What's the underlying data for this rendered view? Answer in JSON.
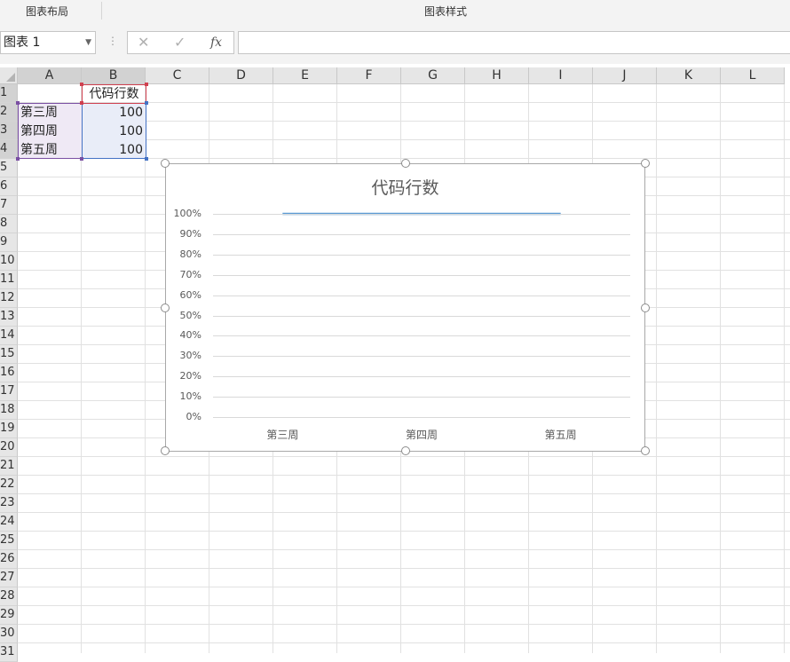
{
  "ribbon": {
    "chart_layout_group": "图表布局",
    "chart_style_group": "图表样式"
  },
  "formula_bar": {
    "name_box": "图表 1",
    "cancel_icon": "close-icon",
    "enter_icon": "check-icon",
    "function_label": "fx",
    "formula": ""
  },
  "columns": [
    "A",
    "B",
    "C",
    "D",
    "E",
    "F",
    "G",
    "H",
    "I",
    "J",
    "K",
    "L"
  ],
  "rows": [
    "1",
    "2",
    "3",
    "4",
    "5",
    "6",
    "7",
    "8",
    "9",
    "10",
    "11",
    "12",
    "13",
    "14",
    "15",
    "16",
    "17",
    "18",
    "19",
    "20",
    "21",
    "22",
    "23",
    "24",
    "25",
    "26",
    "27",
    "28",
    "29",
    "30",
    "31"
  ],
  "cells": {
    "B1": "代码行数",
    "A2": "第三周",
    "B2": "100",
    "A3": "第四周",
    "B3": "100",
    "A4": "第五周",
    "B4": "100"
  },
  "colors": {
    "series_line": "#5b9bd5",
    "range_blue": "#4472c4",
    "range_purple": "#7a4fa3",
    "range_red": "#d0404f"
  },
  "chart_data": {
    "type": "line",
    "title": "代码行数",
    "categories": [
      "第三周",
      "第四周",
      "第五周"
    ],
    "series": [
      {
        "name": "代码行数",
        "values": [
          100,
          100,
          100
        ]
      }
    ],
    "y_ticks": [
      "0%",
      "10%",
      "20%",
      "30%",
      "40%",
      "50%",
      "60%",
      "70%",
      "80%",
      "90%",
      "100%"
    ],
    "ylim": [
      0,
      100
    ],
    "grid": true,
    "legend": "none"
  }
}
